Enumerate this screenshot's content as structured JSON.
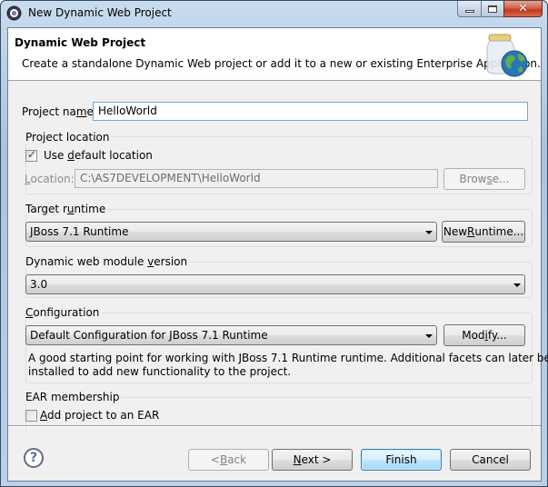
{
  "window": {
    "title": "New Dynamic Web Project",
    "controls": {
      "minimize": "minimize",
      "maximize": "maximize",
      "close": "✕"
    }
  },
  "banner": {
    "title": "Dynamic Web Project",
    "description": "Create a standalone Dynamic Web project or add it to a new or existing Enterprise Application.",
    "icon": "web-project-jar-globe-icon"
  },
  "project_name": {
    "label_pre": "Project na",
    "label_mnemonic": "m",
    "label_post": "e:",
    "value": "HelloWorld"
  },
  "project_location": {
    "legend": "Project location",
    "use_default": {
      "label_pre": "Use ",
      "label_mnemonic": "d",
      "label_post": "efault location",
      "checked": true
    },
    "location_label_mnemonic": "L",
    "location_label_post": "ocation:",
    "location_value": "C:\\AS7DEVELOPMENT\\HelloWorld",
    "browse_pre": "Brow",
    "browse_mnemonic": "s",
    "browse_post": "e..."
  },
  "target_runtime": {
    "legend_pre": "Target r",
    "legend_mnemonic": "u",
    "legend_post": "ntime",
    "selected": "JBoss 7.1 Runtime",
    "new_runtime_pre": "New ",
    "new_runtime_mnemonic": "R",
    "new_runtime_post": "untime..."
  },
  "module_version": {
    "legend_pre": "Dynamic web module ",
    "legend_mnemonic": "v",
    "legend_post": "ersion",
    "selected": "3.0"
  },
  "configuration": {
    "legend_mnemonic": "C",
    "legend_post": "onfiguration",
    "selected": "Default Configuration for JBoss 7.1 Runtime",
    "modify_pre": "Mod",
    "modify_mnemonic": "i",
    "modify_post": "fy...",
    "description_line1": "A good starting point for working with JBoss 7.1 Runtime runtime. Additional facets can later be",
    "description_line2": "installed to add new functionality to the project."
  },
  "ear": {
    "legend": "EAR membership",
    "add_label_mnemonic": "A",
    "add_label_post": "dd project to an EAR",
    "checked": false
  },
  "footer": {
    "help": "?",
    "back_pre": "< ",
    "back_mnemonic": "B",
    "back_post": "ack",
    "next_mnemonic": "N",
    "next_post": "ext >",
    "finish": "Finish",
    "cancel": "Cancel"
  }
}
